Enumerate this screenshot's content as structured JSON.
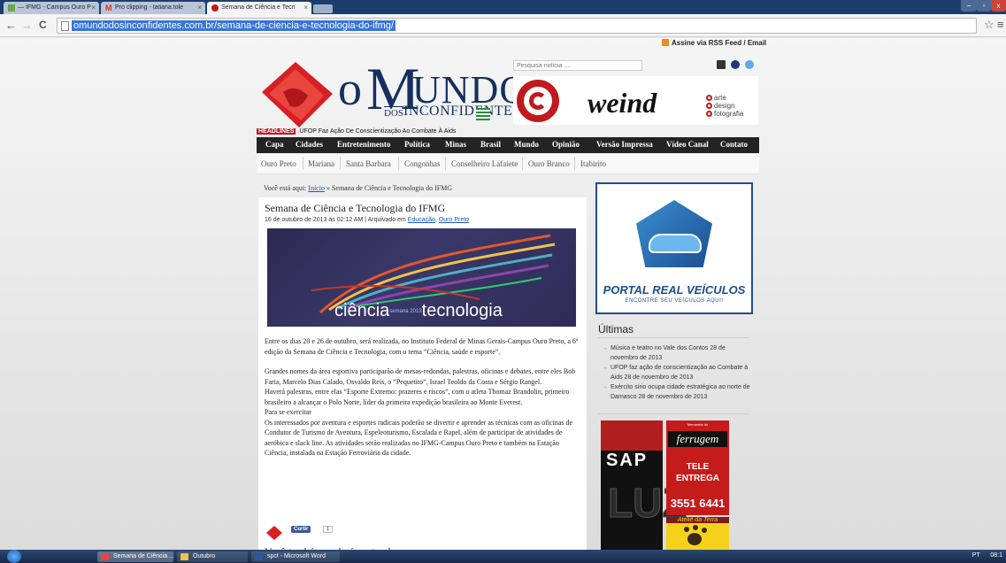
{
  "browser": {
    "tabs": [
      {
        "label": "— IFMG - Campus Ouro P",
        "icon": "ifmg-favicon"
      },
      {
        "label": "Pro clipping - tatiana.tole",
        "icon": "gmail-icon"
      },
      {
        "label": "Semana de Ciência e Tecn",
        "icon": "site-favicon"
      }
    ],
    "url": "omundodosinconfidentes.com.br/semana-de-ciencia-e-tecnologia-do-ifmg/",
    "nav_icons": {
      "back": "←",
      "forward": "→",
      "reload": "C",
      "star": "☆",
      "menu": "≡"
    }
  },
  "site": {
    "rss_label": "Assine via RSS Feed / Email",
    "logo": {
      "o": "o",
      "m": "M",
      "undo": "UNDO",
      "dos": "DOS",
      "inconfidentes": "INCONFIDENTES"
    },
    "search_placeholder": "Pesquisa notícia ....",
    "banner": {
      "brand": "weind",
      "lines": [
        "arte",
        "design",
        "fotografia"
      ]
    },
    "headlines_badge": "HEADLINES",
    "headlines_text": "UFOP Faz Ação De Conscientização Ao Combate À Aids",
    "main_nav": [
      "Capa",
      "Cidades",
      "Entretenimento",
      "Política",
      "Minas",
      "Brasil",
      "Mundo",
      "Opinião",
      "Versão Impressa",
      "Vídeo Canal",
      "Contato"
    ],
    "sub_nav": [
      "Ouro Preto",
      "Mariana",
      "Santa Barbara",
      "Congonhas",
      "Conselheiro Lafaiete",
      "Ouro Branco",
      "Itabirito"
    ]
  },
  "breadcrumb": {
    "prefix": "Você está aqui:",
    "home": "Início",
    "sep": "»",
    "current": "Semana de Ciência e Tecnologia do IFMG"
  },
  "post": {
    "title": "Semana de Ciência e Tecnologia do IFMG",
    "meta_date": "16 de outubro de 2013 as 02:12 AM | Arquivado em",
    "meta_cat1": "Educação",
    "meta_cat2": "Ouro Preto",
    "image_word1": "ciência",
    "image_year": "semana 2013",
    "image_word2": "tecnologia",
    "paragraphs": [
      "Entre os dias 20 e 26 de outubro, será realizada, no Instituto Federal de Minas Gerais-Campus Ouro Preto, a 6ª edição da Semana de Ciência e Tecnologia, com o tema “Ciência, saúde e esporte”.",
      "",
      "Grandes nomes da área esportiva participarão de mesas-redondas, palestras, oficinas e debates, entre eles Bob Faria, Marcelo Dias Calado, Osvaldo Reis, o “Pequetito”, Israel Teoldo da Costa e Sérgio Rangel.",
      "Haverá palestras, entre elas “Esporte Extremo: prazeres e riscos”, com o atleta Thomaz Brandolin, primeiro brasileiro a alcançar o Polo Norte, líder da primeira expedição brasileira ao Monte Everest.",
      "Para se exercitar",
      "Os interessados por aventura e esportes radicais poderão se divertir e aprender as técnicas com as oficinas de Condutor de Turismo de Aventura, Espeleoturismo, Escalada e Rapel, além de participar de atividades de aeróbica e slack line. As atividades serão realizadas no IFMG-Campus Ouro Preto e também na Estação Ciência, instalada na Estação Ferroviária da cidade."
    ],
    "like_label": "Curtir",
    "like_count": "1",
    "maybe_like": "Você também poderá gostar de:"
  },
  "sidebar": {
    "portal_name": "PORTAL REAL VEÍCULOS",
    "portal_tag": "ENCONTRE SEU VEÍCULOS AQUI!",
    "ultimas_title": "Últimas",
    "ultimas": [
      "Música e teatro no Vale dos Contos 28 de novembro de 2013",
      "UFOP faz ação de conscientização ao Combate à Aids 28 de novembro de 2013",
      "Exército sírio ocupa cidade estratégica ao norte de Damasco 28 de novembro de 2013"
    ],
    "ad_sap": "SAP",
    "ad_luz": "LUZ",
    "ad_ferrugem_top": "Mercearia do",
    "ad_ferrugem": "ferrugem",
    "ad_tele": "TELE\nENTREGA",
    "ad_phone": "3551 6441",
    "ad_atelie": "Ateliê da Terra"
  },
  "taskbar": {
    "items": [
      "Semana de Ciência ...",
      "Outubro",
      "spct - Microsoft Word"
    ],
    "tray": "PT",
    "clock": "08:1"
  },
  "colors": {
    "brand_blue": "#15305f",
    "accent_red": "#c1191c",
    "nav_dark": "#232323",
    "link": "#1c57b5"
  }
}
